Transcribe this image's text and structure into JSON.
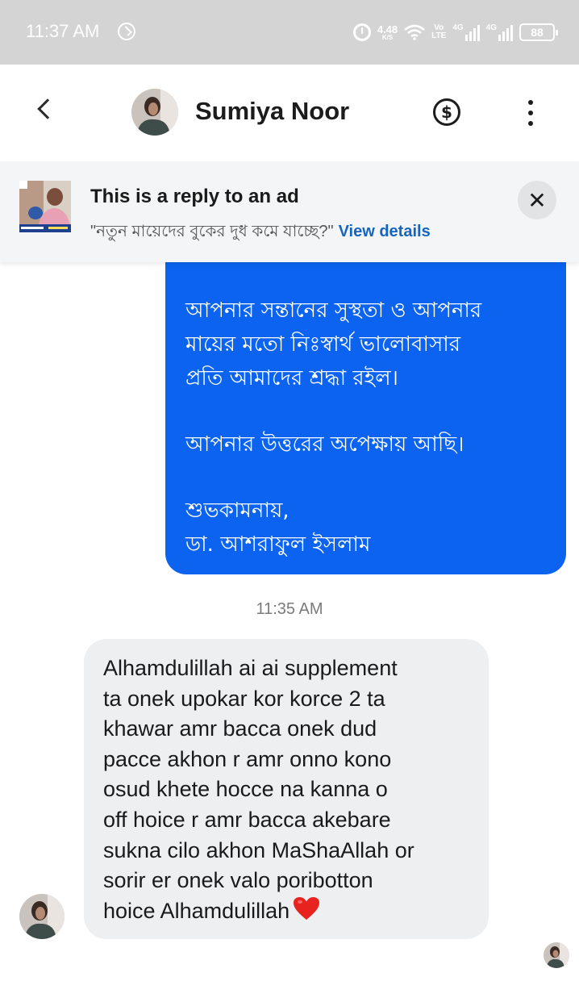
{
  "status_bar": {
    "time": "11:37 AM",
    "net_speed": "4.48",
    "net_speed_unit": "K/S",
    "volte_top": "Vo",
    "volte_bottom": "LTE",
    "sim1_tech": "4G",
    "sim2_tech": "4G",
    "battery": "88"
  },
  "header": {
    "contact_name": "Sumiya Noor"
  },
  "ad_banner": {
    "title": "This is a reply to an ad",
    "quote": "\"নতুন মায়েদের বুকের দুধ কমে যাচ্ছে?\"",
    "link": "View details",
    "close_glyph": "✕"
  },
  "messages": {
    "sent": {
      "lines_1": [
        "আপনার সন্তানের সুস্থতা ও আপনার",
        "মায়ের মতো নিঃস্বার্থ ভালোবাসার",
        "প্রতি আমাদের শ্রদ্ধা রইল।"
      ],
      "line_2": "আপনার উত্তরের অপেক্ষায় আছি।",
      "lines_3": [
        "শুভকামনায়,",
        "ডা. আশরাফুল ইসলাম"
      ]
    },
    "timestamp": "11:35 AM",
    "received": {
      "lines": [
        "Alhamdulillah ai ai supplement",
        "ta onek upokar kor korce 2 ta",
        "khawar amr bacca onek dud",
        "pacce akhon r amr onno kono",
        "osud khete hocce na kanna o",
        "off hoice r amr bacca akebare",
        "sukna cilo akhon MaShaAllah or",
        "sorir er onek valo poribotton",
        "hoice Alhamdulillah"
      ],
      "emoji": "heart-emoji"
    }
  },
  "icons": {
    "back": "back-arrow-icon",
    "payment": "dollar-circle-icon",
    "menu": "more-vertical-icon",
    "close": "close-icon"
  },
  "colors": {
    "sent_bubble": "#0b63ef",
    "received_bubble": "#eeeff1",
    "link": "#1565c0",
    "status_bar": "#d4d4d4"
  }
}
